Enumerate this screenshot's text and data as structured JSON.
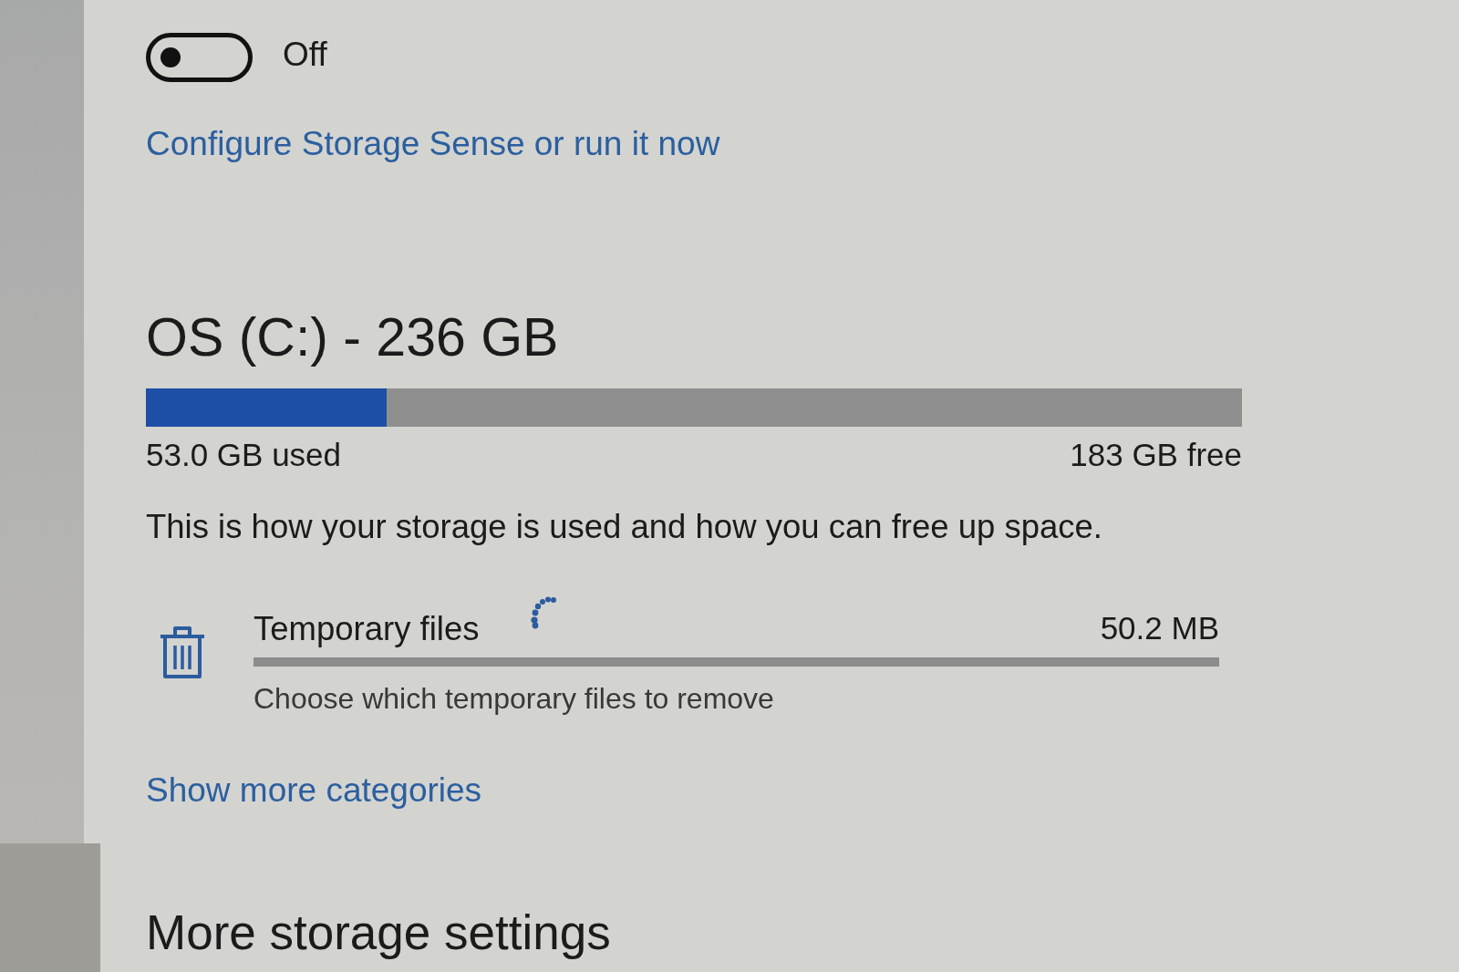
{
  "storage_sense": {
    "toggle": {
      "on": false,
      "label": "Off"
    },
    "link": "Configure Storage Sense or run it now"
  },
  "drive": {
    "title": "OS (C:) - 236 GB",
    "usage": {
      "level": 0.22,
      "used": "53.0 GB used",
      "free": "183 GB free"
    },
    "description": "This is how your storage is used and how you can free up space.",
    "categories": [
      {
        "name": "Temporary files",
        "loading": true,
        "size": "50.2 MB",
        "hint": "Choose which temporary files to remove"
      }
    ],
    "more_link": "Show more categories"
  },
  "more_settings": {
    "title": "More storage settings"
  }
}
